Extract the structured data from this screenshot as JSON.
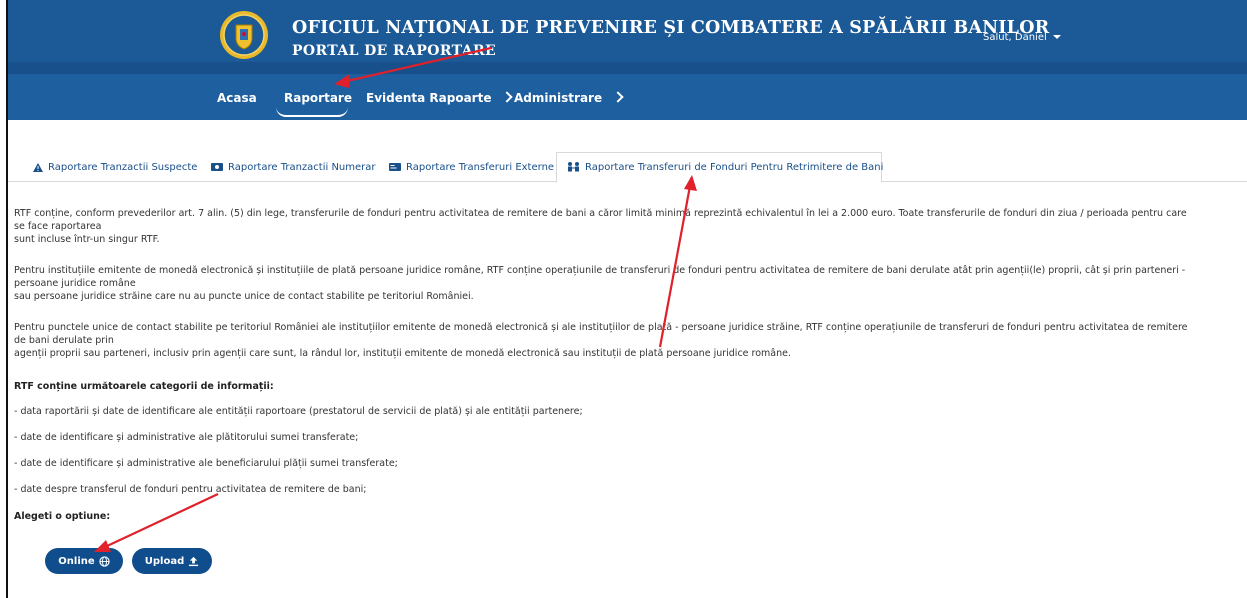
{
  "header": {
    "title_line1": "OFICIUL NAȚIONAL DE PREVENIRE ȘI COMBATERE A SPĂLĂRII BANILOR",
    "title_line2": "PORTAL DE RAPORTARE",
    "user_greeting": "Salut, Daniel",
    "logo": "coat-of-arms-emblem"
  },
  "nav": {
    "items": [
      {
        "label": "Acasa"
      },
      {
        "label": "Raportare",
        "active": true
      },
      {
        "label": "Evidenta Rapoarte",
        "has_chevron": true
      },
      {
        "label": "Administrare",
        "has_chevron": true
      }
    ]
  },
  "tabs": [
    {
      "label": "Raportare Tranzactii Suspecte",
      "icon": "warning-icon"
    },
    {
      "label": "Raportare Tranzactii Numerar",
      "icon": "cash-icon"
    },
    {
      "label": "Raportare Transferuri Externe",
      "icon": "card-icon"
    },
    {
      "label": "Raportare Transferuri de Fonduri Pentru Retrimitere de Bani",
      "icon": "transfer-icon",
      "active": true
    }
  ],
  "content": {
    "p1_a": "RTF conține, conform prevederilor art. 7 alin. (5) din lege, transferurile de fonduri pentru activitatea de remitere de bani a căror limită minimă reprezintă echivalentul în lei a 2.000 euro. Toate transferurile de fonduri din ziua / perioada pentru care",
    "p1_b": "se face raportarea",
    "p1_c": "sunt incluse într-un singur RTF.",
    "p2_a": "Pentru instituțiile emitente de monedă electronică și instituțiile de plată persoane juridice române, RTF conține operațiunile de transferuri de fonduri pentru activitatea de remitere de bani derulate atât prin agenții(le) proprii, cât și prin parteneri -",
    "p2_b": "persoane juridice române",
    "p2_c": "sau persoane juridice străine care nu au puncte unice de contact stabilite pe teritoriul României.",
    "p3_a": "Pentru punctele unice de contact stabilite pe teritoriul României ale instituțiilor emitente de monedă electronică și ale instituțiilor de plată - persoane juridice străine, RTF conține operațiunile de transferuri de fonduri pentru activitatea de remitere",
    "p3_b": "de bani derulate prin",
    "p3_c": "agenții proprii sau parteneri, inclusiv prin agenții care sunt, la rândul lor, instituții emitente de monedă electronică sau instituții de plată persoane juridice române.",
    "categories_title": "RTF conține următoarele categorii de informații:",
    "categories": [
      "- data raportării și date de identificare ale entității raportoare (prestatorul de servicii de plată) și ale entității partenere;",
      "- date de identificare și administrative ale plătitorului sumei transferate;",
      "- date de identificare și administrative ale beneficiarului plății sumei transferate;",
      "- date despre transferul de fonduri pentru activitatea de remitere de bani;"
    ],
    "choose_label": "Alegeti o optiune:"
  },
  "buttons": {
    "online": "Online",
    "upload": "Upload"
  },
  "colors": {
    "header_bg": "#1b5a96",
    "nav_bg": "#1e5fa0",
    "button_bg": "#0f4d8c",
    "annotation_arrow": "#e0202a",
    "logo_gold": "#e8b92a"
  }
}
